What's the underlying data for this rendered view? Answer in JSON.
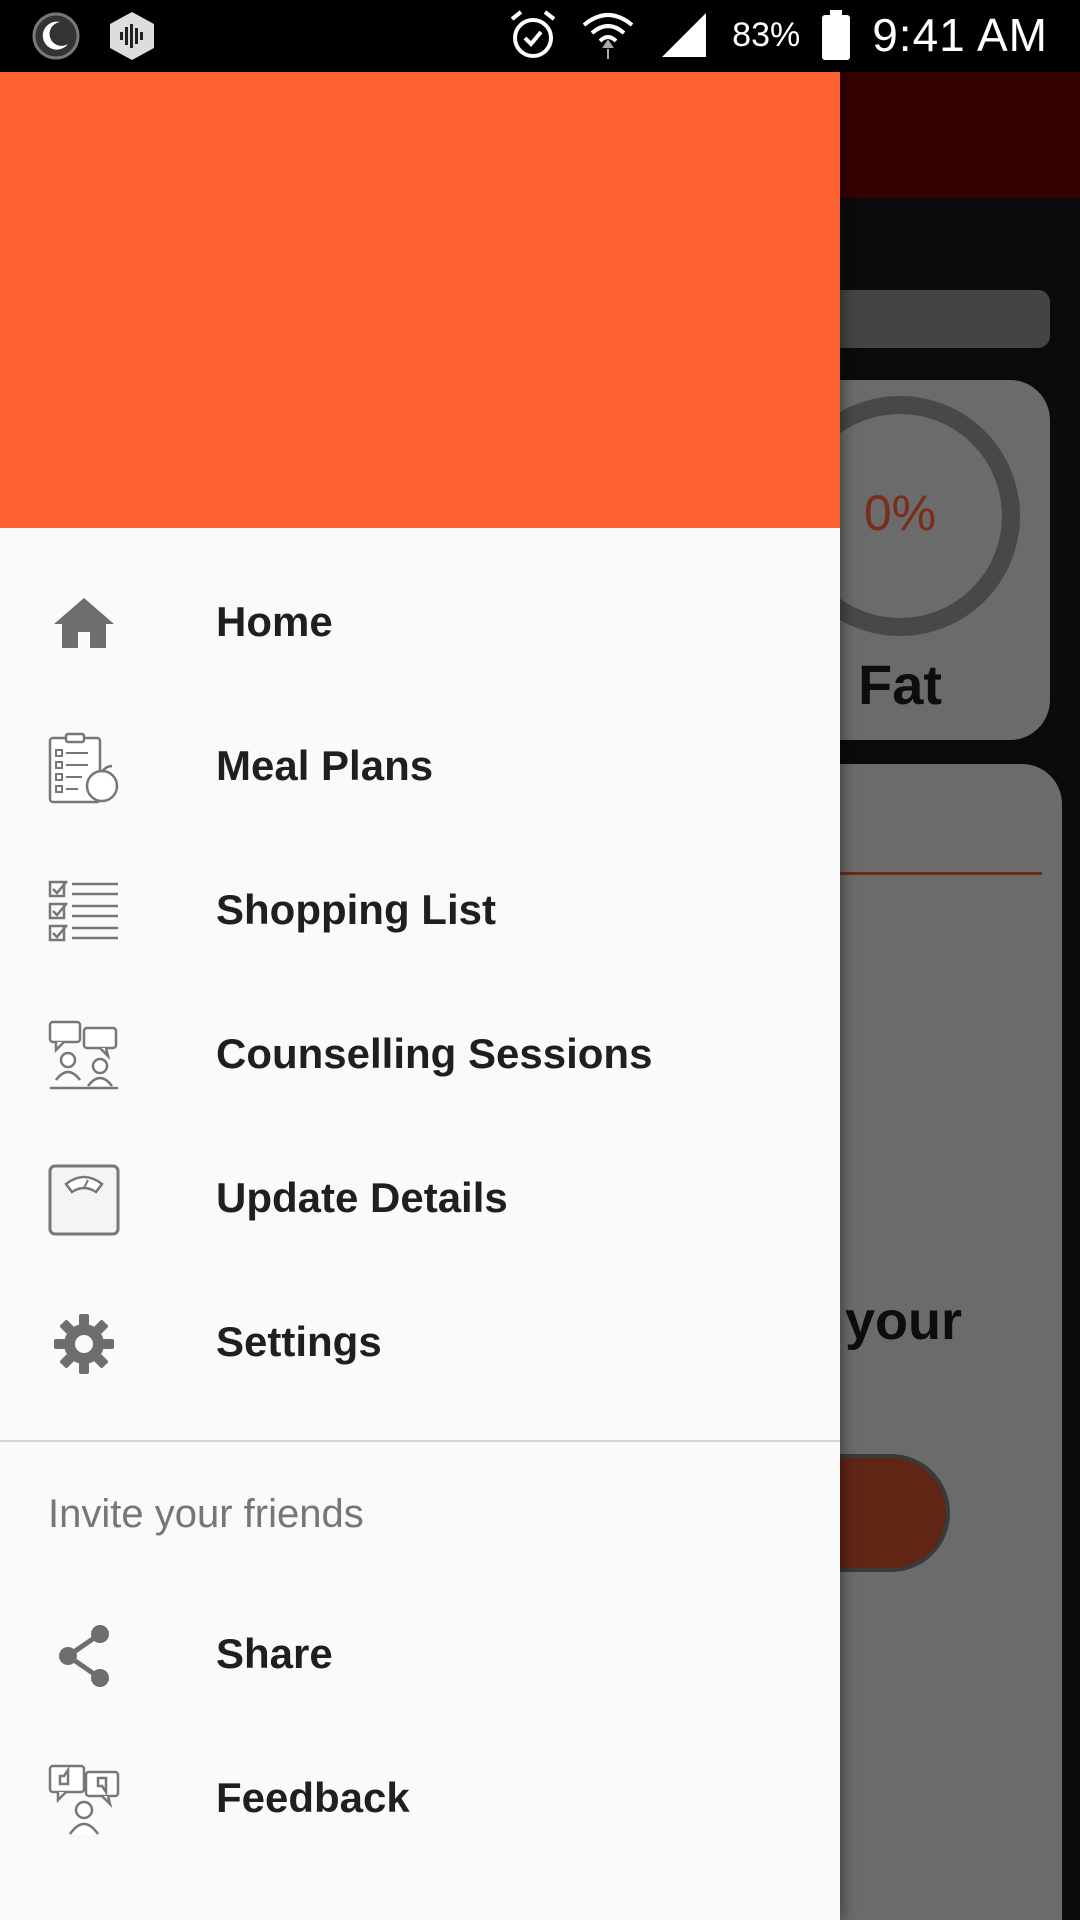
{
  "status_bar": {
    "battery": "83%",
    "time": "9:41 AM"
  },
  "background": {
    "fat_percent": "0%",
    "fat_label": "Fat",
    "fragment_text": "your"
  },
  "drawer": {
    "header_color": "#ff6333",
    "menu": [
      {
        "label": "Home",
        "icon": "home-icon"
      },
      {
        "label": "Meal Plans",
        "icon": "meal-plan-icon"
      },
      {
        "label": "Shopping List",
        "icon": "checklist-icon"
      },
      {
        "label": "Counselling Sessions",
        "icon": "counselling-icon"
      },
      {
        "label": "Update Details",
        "icon": "weighing-scale-icon"
      },
      {
        "label": "Settings",
        "icon": "gear-icon"
      }
    ],
    "section_title": "Invite your friends",
    "secondary_menu": [
      {
        "label": "Share",
        "icon": "share-icon"
      },
      {
        "label": "Feedback",
        "icon": "feedback-icon"
      }
    ]
  }
}
